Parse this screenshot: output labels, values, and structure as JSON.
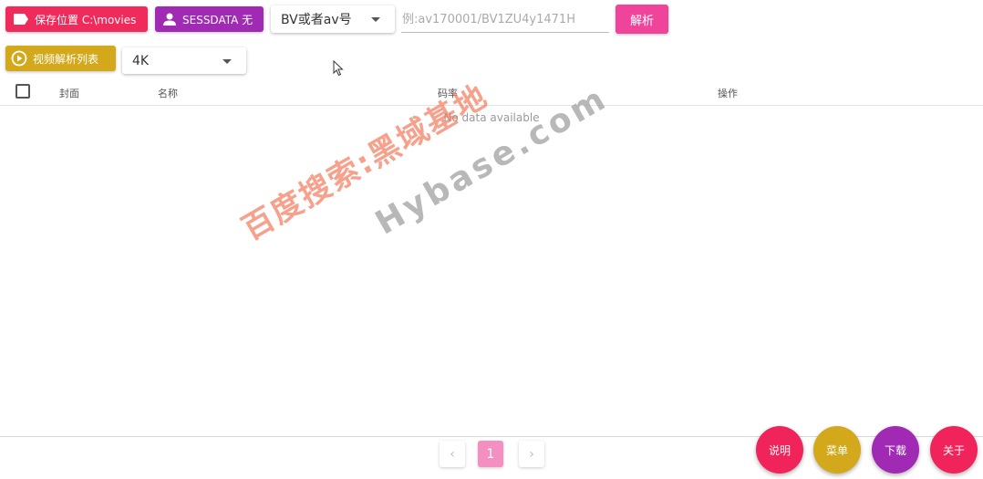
{
  "toolbar": {
    "save_label": "保存位置 C:\\movies",
    "sessdata_label": "SESSDATA 无",
    "id_type_select": "BV或者av号",
    "id_input_placeholder": "例:av170001/BV1ZU4y1471H",
    "id_input_value": "",
    "parse_label": "解析"
  },
  "toolbar2": {
    "list_label": "视频解析列表",
    "quality_select": "4K"
  },
  "table": {
    "columns": [
      "封面",
      "名称",
      "码率",
      "操作"
    ],
    "empty_text": "No data available"
  },
  "watermark": {
    "text_cn": "百度搜索:黑域基地",
    "text_en": "Hybase.com"
  },
  "pagination": {
    "prev": "‹",
    "current": "1",
    "next": "›"
  },
  "fabs": [
    "说明",
    "菜单",
    "下载",
    "关于"
  ],
  "colors": {
    "save": "#f02a5a",
    "sessdata": "#a12ab5",
    "parse": "#f0449b",
    "list": "#d3a81a",
    "fab_help": "#f0245b",
    "fab_menu": "#d3a81a",
    "fab_download": "#a12ab5",
    "fab_about": "#f0245b"
  }
}
